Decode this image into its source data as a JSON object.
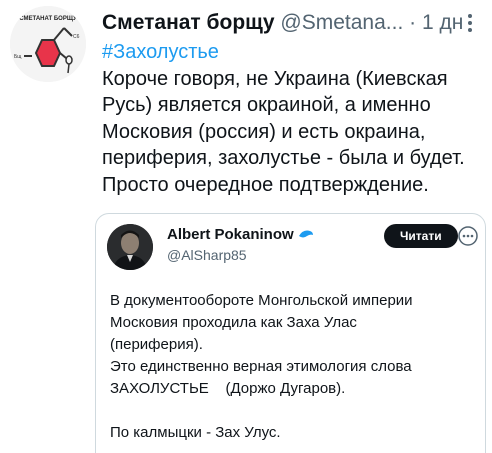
{
  "tweet": {
    "author_name": "Сметанат борщу",
    "author_handle": "@Smetana...",
    "separator": "·",
    "time": "1 дн",
    "avatar_text_top": "СМЕТАНАТ БОРЩУ",
    "avatar_text_right": "C6",
    "avatar_text_left": "Бщ",
    "hashtag": "#Захолустье",
    "text": "Короче говоря, не Украина (Киевская Русь) является окраиной, а именно Московия (россия) и есть окраина, периферия, захолустье - была и будет. Просто очередное подтверждение."
  },
  "quoted": {
    "author_name": "Albert Pokaninow",
    "author_handle": "@AlSharp85",
    "follow_label": "Читати",
    "lines": [
      "В документообороте Монгольской империи",
      "Московия проходила как Заха Улас",
      "(периферия).",
      "Это единственно верная этимология слова",
      "ЗАХОЛУСТЬЕ    (Доржо Дугаров).",
      "",
      "По калмыцки - Зах Улус."
    ]
  },
  "colors": {
    "accent": "#1d9bf0",
    "avatar_hex": "#e8344a",
    "secondary_text": "#536471",
    "border": "#cfd9de"
  }
}
